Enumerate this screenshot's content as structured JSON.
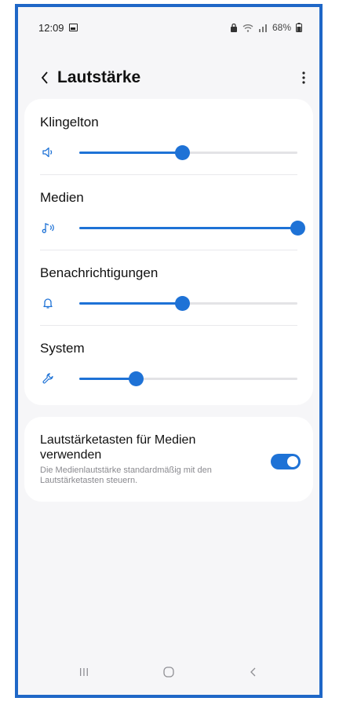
{
  "status_bar": {
    "time": "12:09",
    "battery": "68%",
    "icons": [
      "image-icon",
      "lock-icon",
      "wifi-icon",
      "signal-icon",
      "battery-icon"
    ]
  },
  "app_bar": {
    "title": "Lautstärke",
    "back_icon": "chevron-left-icon",
    "more_icon": "more-vertical-icon"
  },
  "volumes": [
    {
      "label": "Klingelton",
      "icon": "speaker-icon",
      "level": 0.47
    },
    {
      "label": "Medien",
      "icon": "music-note-icon",
      "level": 1.0
    },
    {
      "label": "Benachrichtigungen",
      "icon": "bell-icon",
      "level": 0.47
    },
    {
      "label": "System",
      "icon": "wrench-icon",
      "level": 0.26
    }
  ],
  "media_keys": {
    "title": "Lautstärketasten für Medien verwenden",
    "description": "Die Medienlautstärke standardmäßig mit den Lautstärketasten steuern.",
    "enabled": true
  },
  "nav_bar": {
    "icons": [
      "recent-apps-icon",
      "home-icon",
      "back-icon"
    ]
  },
  "colors": {
    "accent": "#1e72d6",
    "frame": "#1f67c7",
    "background": "#f6f6f8",
    "card": "#ffffff"
  }
}
